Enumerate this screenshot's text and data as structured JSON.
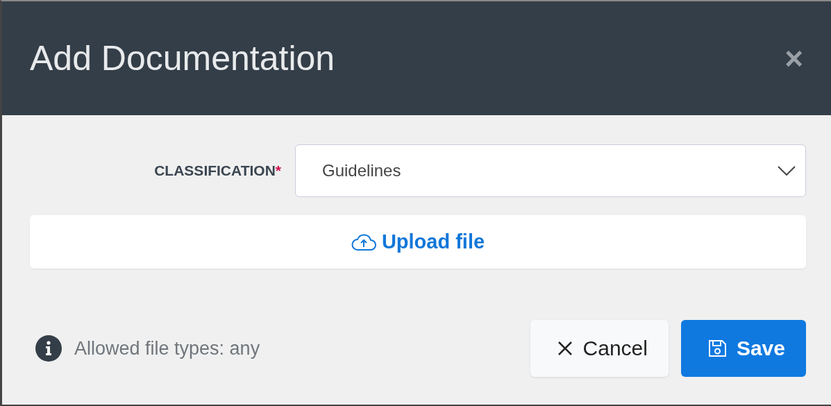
{
  "dialog": {
    "title": "Add Documentation",
    "close_label": "×"
  },
  "classification": {
    "label": "CLASSIFICATION",
    "required_mark": "*",
    "value": "Guidelines"
  },
  "upload": {
    "label": "Upload file"
  },
  "footer": {
    "hint": "Allowed file types: any",
    "buttons": [
      {
        "kind": "cancel",
        "label": "Cancel"
      },
      {
        "kind": "save",
        "label": "Save"
      }
    ]
  }
}
